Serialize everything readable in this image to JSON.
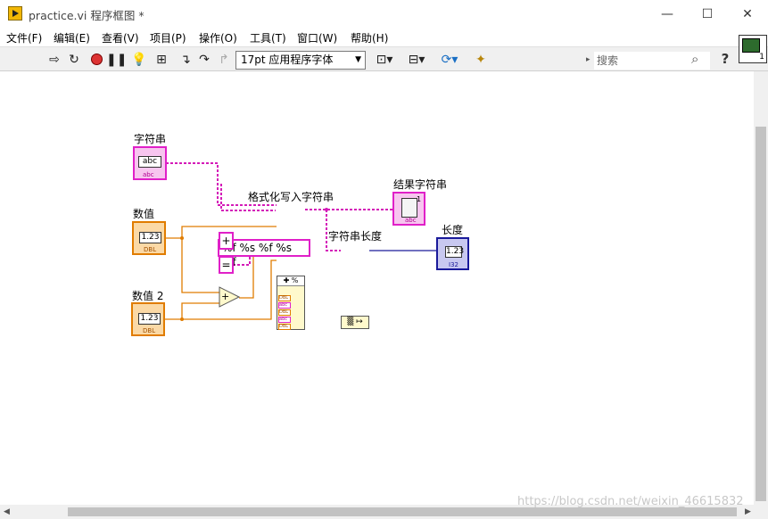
{
  "window": {
    "title": "practice.vi 程序框图 *",
    "controls": {
      "minimize": "—",
      "maximize": "☐",
      "close": "✕"
    }
  },
  "menu": [
    {
      "label": "文件(F)"
    },
    {
      "label": "编辑(E)"
    },
    {
      "label": "查看(V)"
    },
    {
      "label": "项目(P)"
    },
    {
      "label": "操作(O)"
    },
    {
      "label": "工具(T)"
    },
    {
      "label": "窗口(W)"
    },
    {
      "label": "帮助(H)"
    }
  ],
  "toolbar": {
    "font_select": "17pt 应用程序字体",
    "search_placeholder": "搜索",
    "search_prefix": "▸",
    "help": "?",
    "vi_icon_number": "1"
  },
  "diagram": {
    "labels": {
      "string_control": "字符串",
      "number_control": "数值",
      "number_control_2": "数值 2",
      "format_node": "格式化写入字符串",
      "result_indicator": "结果字符串",
      "strlen_node": "字符串长度",
      "length_indicator": "长度"
    },
    "format_constant": "%f %s %f %s %f",
    "plus_constant": "+",
    "equals_constant": "=",
    "string_display": "abc",
    "string_tag": "abc",
    "num_display": "1.23",
    "num_tag": "DBL",
    "length_tag": "I32",
    "format_node_header": "✚ %",
    "format_inputs": [
      "DBL",
      "abc",
      "DBL",
      "abc",
      "DBL"
    ],
    "add_symbol": "+",
    "strlen_symbol": "▒ ↦",
    "result_number": "1"
  },
  "watermark": "https://blog.csdn.net/weixin_46615832",
  "colors": {
    "string_wire": "#d41bb8",
    "numeric_wire": "#e07c00",
    "integer_wire": "#1a1a9a"
  }
}
